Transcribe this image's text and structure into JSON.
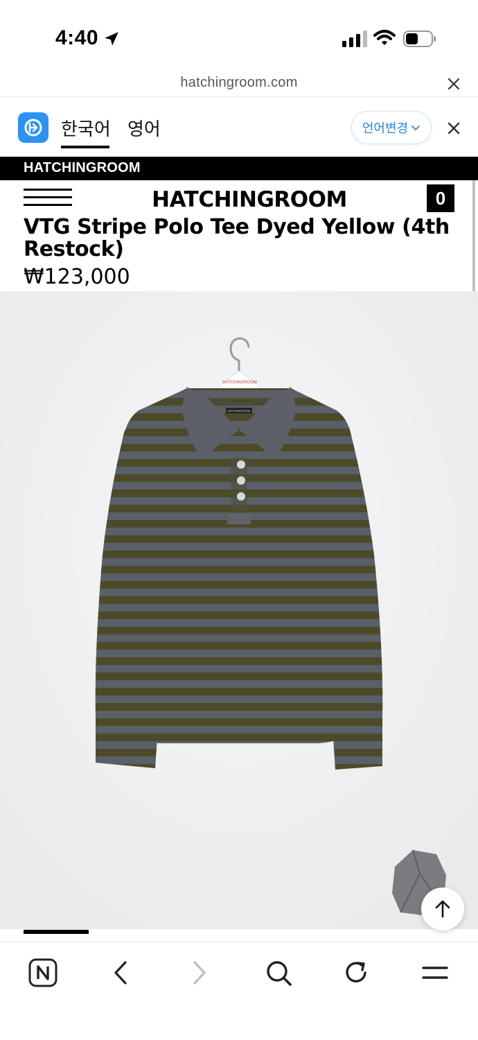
{
  "status_bar": {
    "time": "4:40"
  },
  "browser": {
    "url": "hatchingroom.com"
  },
  "translate_bar": {
    "lang_current": "한국어",
    "lang_target": "영어",
    "change_label": "언어변경"
  },
  "brand_bar": {
    "label": "HATCHINGROOM"
  },
  "header": {
    "logo": "HATCHINGROOM",
    "cart_count": "0"
  },
  "product": {
    "title": "VTG Stripe Polo Tee Dyed Yellow (4th Restock)",
    "price": "₩123,000",
    "hanger_tag": "HATCHINGROOM",
    "label_tag": "HATCHINGROOM"
  },
  "colors": {
    "translate_blue": "#2b93f5",
    "stripe_olive": "#4d4a2a",
    "stripe_gray": "#5b5f68",
    "collar_denim": "#5d6068"
  },
  "icons": [
    "location-arrow-icon",
    "signal-icon",
    "wifi-icon",
    "battery-icon",
    "close-icon",
    "translate-icon",
    "chevron-down-icon",
    "menu-icon",
    "arrow-up-icon",
    "naver-icon",
    "back-icon",
    "forward-icon",
    "search-icon",
    "refresh-icon",
    "menu-icon"
  ]
}
